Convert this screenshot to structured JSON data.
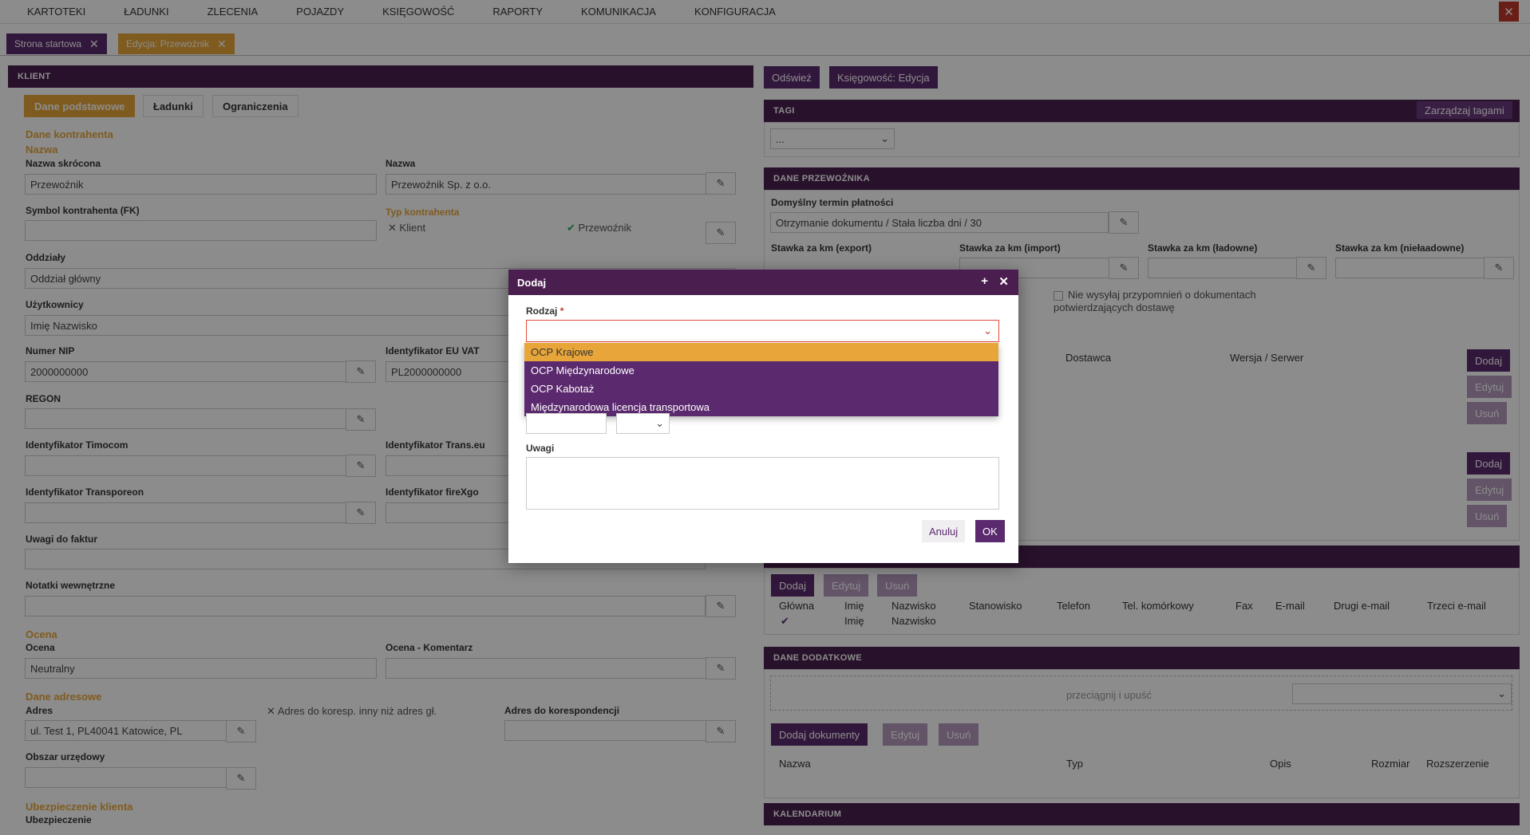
{
  "menu": [
    "KARTOTEKI",
    "ŁADUNKI",
    "ZLECENIA",
    "POJAZDY",
    "KSIĘGOWOŚĆ",
    "RAPORTY",
    "KOMUNIKACJA",
    "KONFIGURACJA"
  ],
  "page_tabs": [
    {
      "label": "Strona startowa"
    },
    {
      "label": "Edycja: Przewoźnik"
    }
  ],
  "client": {
    "header": "KLIENT",
    "subtabs": [
      "Dane podstawowe",
      "Ładunki",
      "Ograniczenia"
    ],
    "sec_contractor": "Dane kontrahenta",
    "sec_name": "Nazwa",
    "short_name_label": "Nazwa skrócona",
    "short_name_value": "Przewoźnik",
    "name_label": "Nazwa",
    "name_value": "Przewoźnik Sp. z o.o.",
    "fk_label": "Symbol kontrahenta (FK)",
    "type_label": "Typ kontrahenta",
    "type_client": "Klient",
    "type_carrier": "Przewoźnik",
    "branches_label": "Oddziały",
    "branches_value": "Oddział główny",
    "users_label": "Użytkownicy",
    "users_value": "Imię Nazwisko",
    "nip_label": "Numer NIP",
    "nip_value": "2000000000",
    "vat_label": "Identyfikator EU VAT",
    "vat_value": "PL2000000000",
    "regon_label": "REGON",
    "timocom_label": "Identyfikator Timocom",
    "transeu_label": "Identyfikator Trans.eu",
    "transporeon_label": "Identyfikator Transporeon",
    "firexgo_label": "Identyfikator fireXgo",
    "invoice_notes_label": "Uwagi do faktur",
    "internal_notes_label": "Notatki wewnętrzne",
    "sec_rating": "Ocena",
    "rating_label": "Ocena",
    "rating_value": "Neutralny",
    "rating_comment_label": "Ocena - Komentarz",
    "sec_address": "Dane adresowe",
    "address_label": "Adres",
    "address_value": "ul. Test 1, PL40041 Katowice, PL",
    "alt_address_check": "Adres do koresp. inny niż adres gł.",
    "corr_address_label": "Adres do korespondencji",
    "office_label": "Obszar urzędowy",
    "sec_insurance": "Ubezpieczenie klienta",
    "insurance_label": "Ubezpieczenie"
  },
  "right": {
    "refresh": "Odśwież",
    "accounting_edit": "Księgowość: Edycja",
    "tags_header": "TAGI",
    "manage_tags": "Zarządzaj tagami",
    "tags_placeholder": "...",
    "carrier_header": "DANE PRZEWOŹNIKA",
    "payment_label": "Domyślny termin płatności",
    "payment_value": "Otrzymanie dokumentu / Stała liczba dni / 30",
    "rate_export": "Stawka za km (export)",
    "rate_import": "Stawka za km (import)",
    "rate_loaded": "Stawka za km (ładowne)",
    "rate_unloaded": "Stawka za km (niełaadowne)",
    "no_reminders": "Nie wysyłaj przypomnień o dokumentach potwierdzających dostawę",
    "col_supplier": "Dostawca",
    "col_version": "Wersja / Serwer",
    "add": "Dodaj",
    "edit": "Edytuj",
    "delete": "Usuń",
    "contacts_cols": [
      "Główna",
      "Imię",
      "Nazwisko",
      "Stanowisko",
      "Telefon",
      "Tel. komórkowy",
      "Fax",
      "E-mail",
      "Drugi e-mail",
      "Trzeci e-mail"
    ],
    "contact_first": "Imię",
    "contact_last": "Nazwisko",
    "extra_header": "DANE DODATKOWE",
    "drop_text": "przeciągnij i upuść",
    "add_docs": "Dodaj dokumenty",
    "docs_cols": [
      "Nazwa",
      "Typ",
      "Opis",
      "Rozmiar",
      "Rozszerzenie"
    ],
    "calendar_header": "KALENDARIUM"
  },
  "modal": {
    "title": "Dodaj",
    "kind_label": "Rodzaj",
    "options": [
      "OCP Krajowe",
      "OCP Międzynarodowe",
      "OCP Kabotaż",
      "Międzynarodowa licencja transportowa"
    ],
    "notes_label": "Uwagi",
    "cancel": "Anuluj",
    "ok": "OK"
  },
  "colors": {
    "primary": "#5b2a6e",
    "header": "#4a1f4f",
    "accent": "#e8a63a",
    "danger": "#c0392b"
  }
}
